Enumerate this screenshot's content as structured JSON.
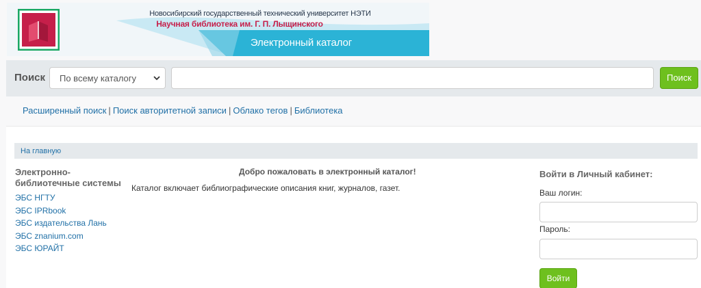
{
  "banner": {
    "university": "Новосибирский государственный технический университет НЭТИ",
    "library": "Научная библиотека им. Г. П. Лыщинского",
    "catalog": "Электронный каталог",
    "logo_icon": "library-book-logo-icon",
    "accent": "#c61f4a",
    "teal": "#2bb3d6"
  },
  "search": {
    "label": "Поиск",
    "scope_selected": "По всему каталогу",
    "input_value": "",
    "button": "Поиск"
  },
  "nav_links": [
    "Расширенный поиск",
    "Поиск авторитетной записи",
    "Облако тегов",
    "Библиотека"
  ],
  "breadcrumb": {
    "home": "На главную"
  },
  "ebs": {
    "title": "Электронно-библиотечные системы",
    "items": [
      "ЭБС НГТУ",
      "ЭБС IPRbook",
      "ЭБС издательства Лань",
      "ЭБС znanium.com",
      "ЭБС ЮРАЙТ"
    ]
  },
  "welcome": {
    "title": "Добро пожаловать в электронный каталог!",
    "text": "Каталог включает библиографические описания книг, журналов, газет."
  },
  "login": {
    "title": "Войти в Личный кабинет:",
    "login_label": "Ваш логин:",
    "password_label": "Пароль:",
    "button": "Войти",
    "button_color": "#6ec01e"
  }
}
